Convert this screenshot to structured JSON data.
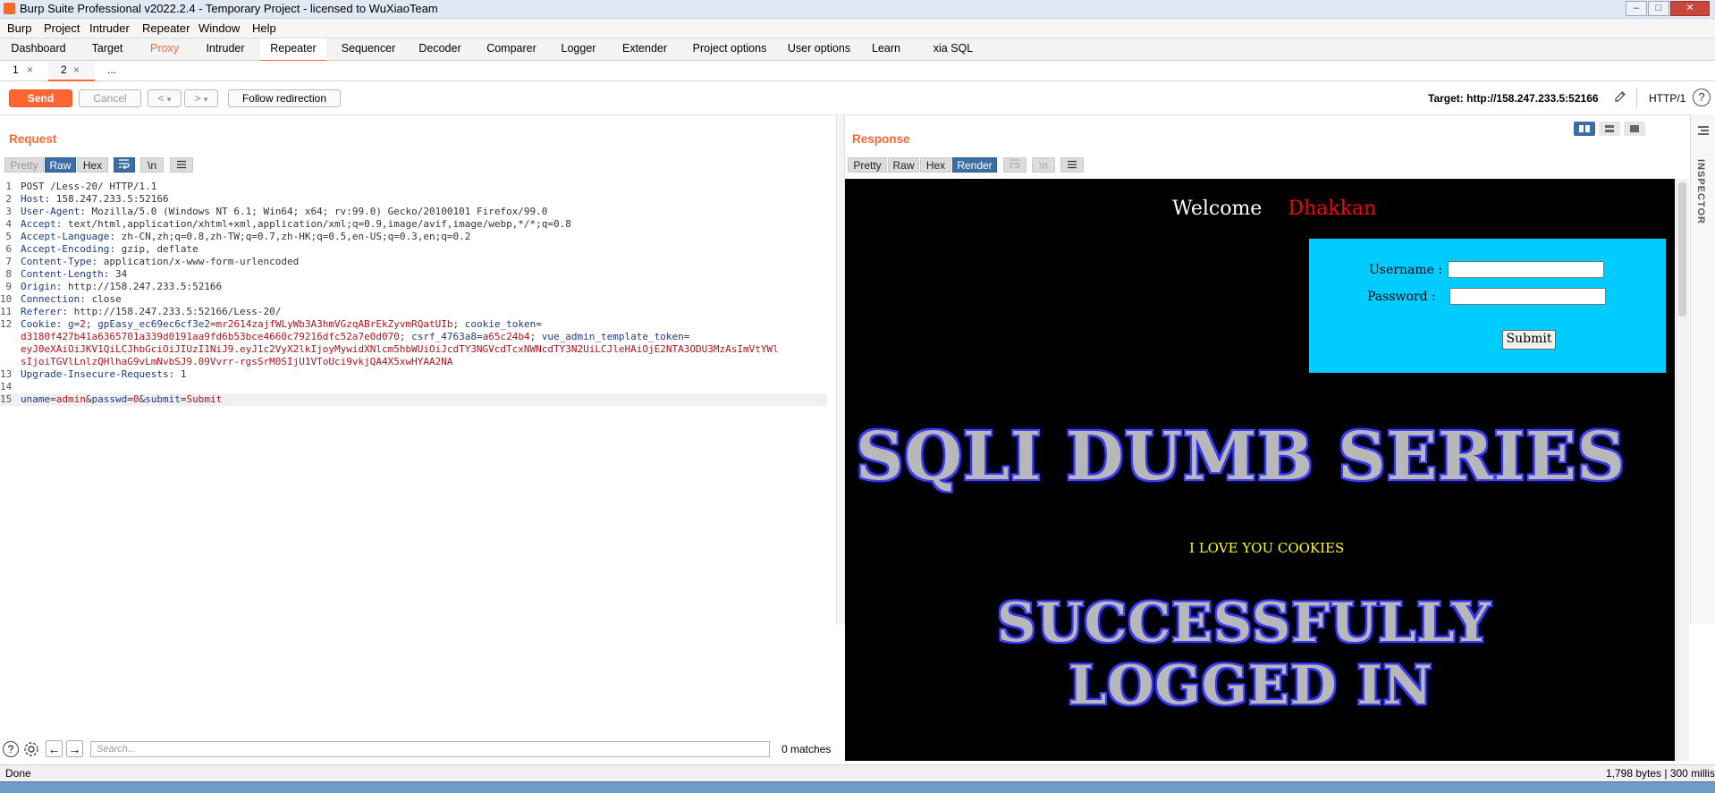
{
  "window": {
    "title": "Burp Suite Professional v2022.2.4 - Temporary Project - licensed to WuXiaoTeam",
    "min_glyph": "–",
    "max_glyph": "□",
    "close_glyph": "✕"
  },
  "menu": [
    "Burp",
    "Project",
    "Intruder",
    "Repeater",
    "Window",
    "Help"
  ],
  "tool_tabs": [
    "Dashboard",
    "Target",
    "Proxy",
    "Intruder",
    "Repeater",
    "Sequencer",
    "Decoder",
    "Comparer",
    "Logger",
    "Extender",
    "Project options",
    "User options",
    "Learn",
    "xia SQL"
  ],
  "active_tool_tab": "Repeater",
  "sub_tabs": [
    {
      "label": "1",
      "close": "×"
    },
    {
      "label": "2",
      "close": "×"
    },
    {
      "label": "...",
      "close": ""
    }
  ],
  "toolbar": {
    "send": "Send",
    "cancel": "Cancel",
    "back": "<",
    "back_dd": "▾",
    "forward": ">",
    "forward_dd": "▾",
    "follow": "Follow redirection",
    "target": "Target: http://158.247.233.5:52166",
    "http_version": "HTTP/1",
    "help": "?"
  },
  "request": {
    "title": "Request",
    "view_tabs": [
      "Pretty",
      "Raw",
      "Hex"
    ],
    "active_view": "Raw",
    "newline_toggle": "\\n",
    "lines": [
      {
        "n": "1",
        "parts": [
          {
            "t": "POST /Less-20/ HTTP/1.1",
            "c": "plain"
          }
        ]
      },
      {
        "n": "2",
        "parts": [
          {
            "t": "Host",
            "c": "hk"
          },
          {
            "t": ": 158.247.233.5:52166",
            "c": "plain"
          }
        ]
      },
      {
        "n": "3",
        "parts": [
          {
            "t": "User-Agent",
            "c": "hk"
          },
          {
            "t": ": Mozilla/5.0 (Windows NT 6.1; Win64; x64; rv:99.0) Gecko/20100101 Firefox/99.0",
            "c": "plain"
          }
        ]
      },
      {
        "n": "4",
        "parts": [
          {
            "t": "Accept",
            "c": "hk"
          },
          {
            "t": ": text/html,application/xhtml+xml,application/xml;q=0.9,image/avif,image/webp,*/*;q=0.8",
            "c": "plain"
          }
        ]
      },
      {
        "n": "5",
        "parts": [
          {
            "t": "Accept-Language",
            "c": "hk"
          },
          {
            "t": ": zh-CN,zh;q=0.8,zh-TW;q=0.7,zh-HK;q=0.5,en-US;q=0.3,en;q=0.2",
            "c": "plain"
          }
        ]
      },
      {
        "n": "6",
        "parts": [
          {
            "t": "Accept-Encoding",
            "c": "hk"
          },
          {
            "t": ": gzip, deflate",
            "c": "plain"
          }
        ]
      },
      {
        "n": "7",
        "parts": [
          {
            "t": "Content-Type",
            "c": "hk"
          },
          {
            "t": ": application/x-www-form-urlencoded",
            "c": "plain"
          }
        ]
      },
      {
        "n": "8",
        "parts": [
          {
            "t": "Content-Length",
            "c": "hk"
          },
          {
            "t": ": 34",
            "c": "plain"
          }
        ]
      },
      {
        "n": "9",
        "parts": [
          {
            "t": "Origin",
            "c": "hk"
          },
          {
            "t": ": http://158.247.233.5:52166",
            "c": "plain"
          }
        ]
      },
      {
        "n": "10",
        "parts": [
          {
            "t": "Connection",
            "c": "hk"
          },
          {
            "t": ": close",
            "c": "plain"
          }
        ]
      },
      {
        "n": "11",
        "parts": [
          {
            "t": "Referer",
            "c": "hk"
          },
          {
            "t": ": http://158.247.233.5:52166/Less-20/",
            "c": "plain"
          }
        ]
      },
      {
        "n": "12",
        "parts": [
          {
            "t": "Cookie",
            "c": "hk"
          },
          {
            "t": ": ",
            "c": "plain"
          },
          {
            "t": "g",
            "c": "pk"
          },
          {
            "t": "=",
            "c": "plain"
          },
          {
            "t": "2",
            "c": "cv"
          },
          {
            "t": "; ",
            "c": "plain"
          },
          {
            "t": "gpEasy_ec69ec6cf3e2",
            "c": "pk"
          },
          {
            "t": "=",
            "c": "plain"
          },
          {
            "t": "mr2614zajfWLyWb3A3hmVGzqABrEkZyvmRQatUIb",
            "c": "cv"
          },
          {
            "t": "; ",
            "c": "plain"
          },
          {
            "t": "cookie_token",
            "c": "pk"
          },
          {
            "t": "=",
            "c": "plain"
          }
        ]
      },
      {
        "n": "",
        "parts": [
          {
            "t": "d3180f427b41a6365701a339d0191aa9fd6b53bce4660c79216dfc52a7e0d070",
            "c": "cv"
          },
          {
            "t": "; ",
            "c": "plain"
          },
          {
            "t": "csrf_4763a8",
            "c": "pk"
          },
          {
            "t": "=",
            "c": "plain"
          },
          {
            "t": "a65c24b4",
            "c": "cv"
          },
          {
            "t": "; ",
            "c": "plain"
          },
          {
            "t": "vue_admin_template_token",
            "c": "pk"
          },
          {
            "t": "=",
            "c": "plain"
          }
        ]
      },
      {
        "n": "",
        "parts": [
          {
            "t": "eyJ0eXAiOiJKV1QiLCJhbGciOiJIUzI1NiJ9.eyJ1c2VyX2lkIjoyMywidXNlcm5hbWUiOiJcdTY3NGVcdTcxNWNcdTY3N2UiLCJleHAiOjE2NTA3ODU3MzAsImVtYWl",
            "c": "cv"
          }
        ]
      },
      {
        "n": "",
        "parts": [
          {
            "t": "sIjoiTGVlLnlzQHlhaG9vLmNvbSJ9.09Vvrr-rgsSrM0SIjU1VToUci9vkjQA4X5xwHYAA2NA",
            "c": "cv"
          }
        ]
      },
      {
        "n": "13",
        "parts": [
          {
            "t": "Upgrade-Insecure-Requests",
            "c": "hk"
          },
          {
            "t": ": 1",
            "c": "plain"
          }
        ]
      },
      {
        "n": "14",
        "parts": []
      },
      {
        "n": "15",
        "parts": [
          {
            "t": "uname",
            "c": "pk"
          },
          {
            "t": "=",
            "c": "plain"
          },
          {
            "t": "admin",
            "c": "pv"
          },
          {
            "t": "&",
            "c": "plain"
          },
          {
            "t": "passwd",
            "c": "pk"
          },
          {
            "t": "=",
            "c": "plain"
          },
          {
            "t": "0",
            "c": "pv"
          },
          {
            "t": "&",
            "c": "plain"
          },
          {
            "t": "submit",
            "c": "pk"
          },
          {
            "t": "=",
            "c": "plain"
          },
          {
            "t": "Submit",
            "c": "pv"
          }
        ]
      }
    ],
    "search_placeholder": "Search...",
    "matches": "0 matches"
  },
  "response": {
    "title": "Response",
    "view_tabs": [
      "Pretty",
      "Raw",
      "Hex",
      "Render"
    ],
    "active_view": "Render",
    "render": {
      "welcome": "Welcome",
      "name": "Dhakkan",
      "username_label": "Username :",
      "password_label": "Password :",
      "submit": "Submit",
      "banner": "SQLI DUMB SERIES",
      "message": "I LOVE YOU COOKIES",
      "success_line1": "SUCCESSFULLY",
      "success_line2": "LOGGED IN"
    }
  },
  "inspector": {
    "label": "INSPECTOR"
  },
  "status": {
    "left": "Done",
    "right": "1,798 bytes | 300 millis"
  },
  "colors": {
    "accent": "#ff6633",
    "form_bg": "#00ccff",
    "welcome_name": "#ff0000",
    "message": "#ffff00"
  }
}
